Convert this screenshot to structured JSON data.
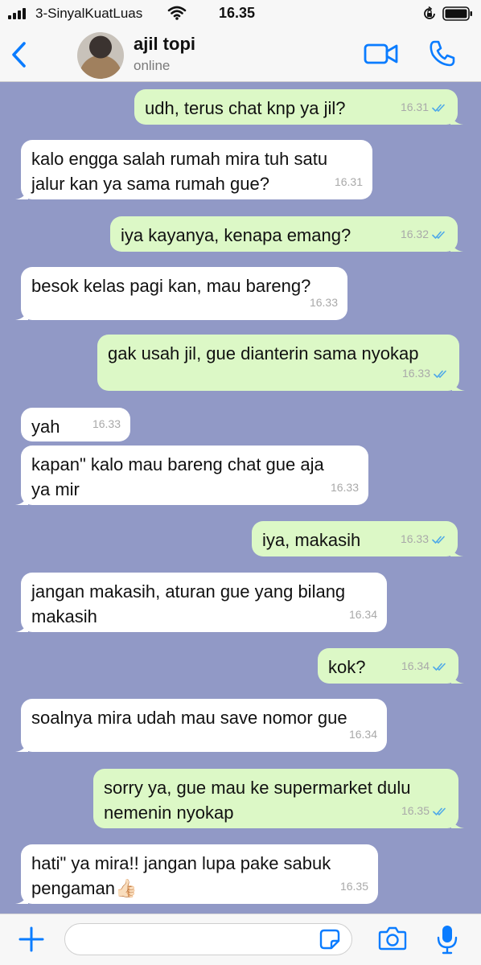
{
  "status_bar": {
    "carrier": "3-SinyalKuatLuas",
    "time": "16.35"
  },
  "header": {
    "contact_name": "ajil topi",
    "contact_status": "online"
  },
  "colors": {
    "accent": "#0a7cff",
    "chat_background": "#9199c6",
    "outgoing_bubble": "#dcf8c6",
    "incoming_bubble": "#ffffff",
    "read_tick": "#4fa9e8"
  },
  "messages": [
    {
      "dir": "out",
      "text": "udh, terus chat knp ya jil?",
      "time": "16.31"
    },
    {
      "dir": "in",
      "text": "kalo engga salah rumah mira tuh satu\njalur kan ya sama rumah gue?",
      "time": "16.31"
    },
    {
      "dir": "out",
      "text": "iya kayanya, kenapa emang?",
      "time": "16.32"
    },
    {
      "dir": "in",
      "text": "besok kelas pagi kan, mau bareng?",
      "time": "16.33"
    },
    {
      "dir": "out",
      "text": "gak usah jil, gue dianterin sama nyokap",
      "time": "16.33"
    },
    {
      "dir": "in",
      "text": "yah",
      "time": "16.33"
    },
    {
      "dir": "in",
      "text": "kapan\" kalo mau bareng chat gue aja\nya mir",
      "time": "16.33"
    },
    {
      "dir": "out",
      "text": "iya, makasih",
      "time": "16.33"
    },
    {
      "dir": "in",
      "text": "jangan makasih, aturan gue yang bilang\nmakasih",
      "time": "16.34"
    },
    {
      "dir": "out",
      "text": "kok?",
      "time": "16.34"
    },
    {
      "dir": "in",
      "text": "soalnya mira udah mau save nomor gue",
      "time": "16.34"
    },
    {
      "dir": "out",
      "text": "sorry ya, gue mau ke supermarket dulu\nnemenin nyokap",
      "time": "16.35"
    },
    {
      "dir": "in",
      "text": "hati\" ya mira!! jangan lupa pake sabuk\npengaman👍🏻",
      "time": "16.35"
    }
  ],
  "composer": {
    "placeholder": ""
  },
  "icons": [
    "signal-icon",
    "wifi-icon",
    "rotation-lock-icon",
    "battery-icon",
    "back-chevron-icon",
    "video-camera-icon",
    "phone-icon",
    "plus-icon",
    "sticker-icon",
    "camera-icon",
    "microphone-icon",
    "double-check-icon"
  ]
}
